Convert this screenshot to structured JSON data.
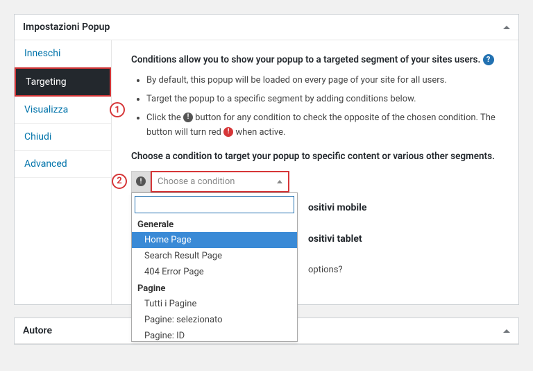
{
  "panel1": {
    "title": "Impostazioni Popup"
  },
  "panel2": {
    "title": "Autore"
  },
  "tabs": {
    "items": [
      {
        "label": "Inneschi"
      },
      {
        "label": "Targeting"
      },
      {
        "label": "Visualizza"
      },
      {
        "label": "Chiudi"
      },
      {
        "label": "Advanced"
      }
    ],
    "activeIndex": 1
  },
  "markers": {
    "one": "1",
    "two": "2"
  },
  "content": {
    "intro": "Conditions allow you to show your popup to a targeted segment of your sites users.",
    "bullets": [
      "By default, this popup will be loaded on every page of your site for all users.",
      "Target the popup to a specific segment by adding conditions below.",
      {
        "pre": "Click the ",
        "mid": " button for any condition to check the opposite of the chosen condition. The button will turn red ",
        "post": " when active."
      }
    ],
    "subhead": "Choose a condition to target your popup to specific content or various other segments.",
    "select_placeholder": "Choose a condition",
    "behind": {
      "mobile": "ositivi mobile",
      "tablet": "ositivi tablet",
      "options": "options?"
    }
  },
  "dropdown": {
    "search_value": "",
    "groups": [
      {
        "label": "Generale",
        "items": [
          "Home Page",
          "Search Result Page",
          "404 Error Page"
        ],
        "highlight": 0
      },
      {
        "label": "Pagine",
        "items": [
          "Tutti i Pagine",
          "Pagine: selezionato",
          "Pagine: ID"
        ]
      }
    ]
  }
}
